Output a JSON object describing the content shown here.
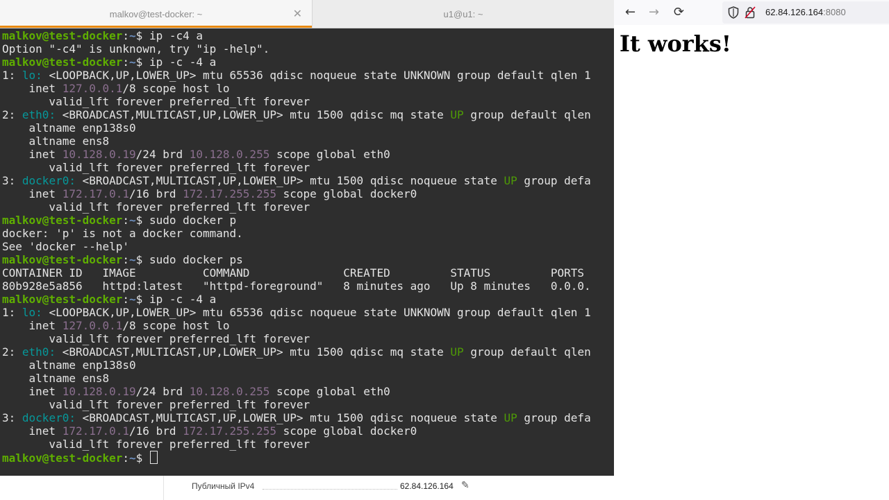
{
  "terminal": {
    "tabs": [
      {
        "title": "malkov@test-docker: ~"
      },
      {
        "title": "u1@u1: ~"
      }
    ],
    "lines": [
      [
        {
          "t": "malkov@test-docker",
          "c": "u"
        },
        {
          "t": ":",
          "c": ""
        },
        {
          "t": "~",
          "c": "path"
        },
        {
          "t": "$ ip -c4 a",
          "c": ""
        }
      ],
      [
        {
          "t": "Option \"-c4\" is unknown, try \"ip -help\".",
          "c": ""
        }
      ],
      [
        {
          "t": "malkov@test-docker",
          "c": "u"
        },
        {
          "t": ":",
          "c": ""
        },
        {
          "t": "~",
          "c": "path"
        },
        {
          "t": "$ ip -c -4 a",
          "c": ""
        }
      ],
      [
        {
          "t": "1: ",
          "c": ""
        },
        {
          "t": "lo:",
          "c": "cy"
        },
        {
          "t": " <LOOPBACK,UP,LOWER_UP> mtu 65536 qdisc noqueue state UNKNOWN group default qlen 1",
          "c": ""
        }
      ],
      [
        {
          "t": "    inet ",
          "c": ""
        },
        {
          "t": "127.0.0.1",
          "c": "mg"
        },
        {
          "t": "/8 scope host lo",
          "c": ""
        }
      ],
      [
        {
          "t": "       valid_lft forever preferred_lft forever",
          "c": ""
        }
      ],
      [
        {
          "t": "2: ",
          "c": ""
        },
        {
          "t": "eth0:",
          "c": "cy"
        },
        {
          "t": " <BROADCAST,MULTICAST,UP,LOWER_UP> mtu 1500 qdisc mq state ",
          "c": ""
        },
        {
          "t": "UP",
          "c": "gr"
        },
        {
          "t": " group default qlen",
          "c": ""
        }
      ],
      [
        {
          "t": "    altname enp138s0",
          "c": ""
        }
      ],
      [
        {
          "t": "    altname ens8",
          "c": ""
        }
      ],
      [
        {
          "t": "    inet ",
          "c": ""
        },
        {
          "t": "10.128.0.19",
          "c": "mg"
        },
        {
          "t": "/24 brd ",
          "c": ""
        },
        {
          "t": "10.128.0.255",
          "c": "mg"
        },
        {
          "t": " scope global eth0",
          "c": ""
        }
      ],
      [
        {
          "t": "       valid_lft forever preferred_lft forever",
          "c": ""
        }
      ],
      [
        {
          "t": "3: ",
          "c": ""
        },
        {
          "t": "docker0:",
          "c": "cy"
        },
        {
          "t": " <BROADCAST,MULTICAST,UP,LOWER_UP> mtu 1500 qdisc noqueue state ",
          "c": ""
        },
        {
          "t": "UP",
          "c": "gr"
        },
        {
          "t": " group defa",
          "c": ""
        }
      ],
      [
        {
          "t": "    inet ",
          "c": ""
        },
        {
          "t": "172.17.0.1",
          "c": "mg"
        },
        {
          "t": "/16 brd ",
          "c": ""
        },
        {
          "t": "172.17.255.255",
          "c": "mg"
        },
        {
          "t": " scope global docker0",
          "c": ""
        }
      ],
      [
        {
          "t": "       valid_lft forever preferred_lft forever",
          "c": ""
        }
      ],
      [
        {
          "t": "malkov@test-docker",
          "c": "u"
        },
        {
          "t": ":",
          "c": ""
        },
        {
          "t": "~",
          "c": "path"
        },
        {
          "t": "$ sudo docker p",
          "c": ""
        }
      ],
      [
        {
          "t": "docker: 'p' is not a docker command.",
          "c": ""
        }
      ],
      [
        {
          "t": "See 'docker --help'",
          "c": ""
        }
      ],
      [
        {
          "t": "malkov@test-docker",
          "c": "u"
        },
        {
          "t": ":",
          "c": ""
        },
        {
          "t": "~",
          "c": "path"
        },
        {
          "t": "$ sudo docker ps",
          "c": ""
        }
      ],
      [
        {
          "t": "CONTAINER ID   IMAGE          COMMAND              CREATED         STATUS         PORTS",
          "c": ""
        }
      ],
      [
        {
          "t": "80b928e5a856   httpd:latest   \"httpd-foreground\"   8 minutes ago   Up 8 minutes   0.0.0.",
          "c": ""
        }
      ],
      [
        {
          "t": "malkov@test-docker",
          "c": "u"
        },
        {
          "t": ":",
          "c": ""
        },
        {
          "t": "~",
          "c": "path"
        },
        {
          "t": "$ ip -c -4 a",
          "c": ""
        }
      ],
      [
        {
          "t": "1: ",
          "c": ""
        },
        {
          "t": "lo:",
          "c": "cy"
        },
        {
          "t": " <LOOPBACK,UP,LOWER_UP> mtu 65536 qdisc noqueue state UNKNOWN group default qlen 1",
          "c": ""
        }
      ],
      [
        {
          "t": "    inet ",
          "c": ""
        },
        {
          "t": "127.0.0.1",
          "c": "mg"
        },
        {
          "t": "/8 scope host lo",
          "c": ""
        }
      ],
      [
        {
          "t": "       valid_lft forever preferred_lft forever",
          "c": ""
        }
      ],
      [
        {
          "t": "2: ",
          "c": ""
        },
        {
          "t": "eth0:",
          "c": "cy"
        },
        {
          "t": " <BROADCAST,MULTICAST,UP,LOWER_UP> mtu 1500 qdisc mq state ",
          "c": ""
        },
        {
          "t": "UP",
          "c": "gr"
        },
        {
          "t": " group default qlen",
          "c": ""
        }
      ],
      [
        {
          "t": "    altname enp138s0",
          "c": ""
        }
      ],
      [
        {
          "t": "    altname ens8",
          "c": ""
        }
      ],
      [
        {
          "t": "    inet ",
          "c": ""
        },
        {
          "t": "10.128.0.19",
          "c": "mg"
        },
        {
          "t": "/24 brd ",
          "c": ""
        },
        {
          "t": "10.128.0.255",
          "c": "mg"
        },
        {
          "t": " scope global eth0",
          "c": ""
        }
      ],
      [
        {
          "t": "       valid_lft forever preferred_lft forever",
          "c": ""
        }
      ],
      [
        {
          "t": "3: ",
          "c": ""
        },
        {
          "t": "docker0:",
          "c": "cy"
        },
        {
          "t": " <BROADCAST,MULTICAST,UP,LOWER_UP> mtu 1500 qdisc noqueue state ",
          "c": ""
        },
        {
          "t": "UP",
          "c": "gr"
        },
        {
          "t": " group defa",
          "c": ""
        }
      ],
      [
        {
          "t": "    inet ",
          "c": ""
        },
        {
          "t": "172.17.0.1",
          "c": "mg"
        },
        {
          "t": "/16 brd ",
          "c": ""
        },
        {
          "t": "172.17.255.255",
          "c": "mg"
        },
        {
          "t": " scope global docker0",
          "c": ""
        }
      ],
      [
        {
          "t": "       valid_lft forever preferred_lft forever",
          "c": ""
        }
      ],
      [
        {
          "t": "malkov@test-docker",
          "c": "u"
        },
        {
          "t": ":",
          "c": ""
        },
        {
          "t": "~",
          "c": "path"
        },
        {
          "t": "$ ",
          "c": ""
        }
      ]
    ],
    "colors": {
      "background": "#2e2e2e",
      "user": "#5faf00",
      "path": "#6d8fbf",
      "interface": "#06989a",
      "address": "#8b6f8f",
      "state_up": "#4e9a06",
      "tab_accent": "#e8890c"
    }
  },
  "browser": {
    "back_icon": "←",
    "forward_icon": "→",
    "reload_icon": "⟳",
    "url_host": "62.84.126.164",
    "url_port": ":8080",
    "page_heading": "It works!"
  },
  "background_page": {
    "row_label": "Публичный IPv4",
    "row_value": "62.84.126.164"
  }
}
